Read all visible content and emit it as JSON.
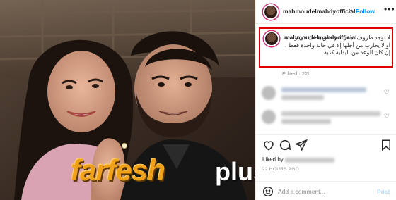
{
  "post": {
    "username": "mahmoudelmahdyofficial",
    "follow_label": "Follow",
    "separator": "•",
    "more_icon": "more-horizontal-icon"
  },
  "caption": {
    "username": "mahmoudelmahdyofficial",
    "text": "لا توجد ظروف تجعل الشخص يخلف في وعده او لا يحارب من أجلها إلا في حالة واحدة فقط ، إن كان الوعد من البداية كذبة",
    "edited": "Edited · 22h",
    "highlight_color": "#e00000"
  },
  "actions": {
    "icons": [
      "heart-icon",
      "comment-icon",
      "share-icon",
      "bookmark-icon"
    ]
  },
  "likes": {
    "prefix": "Liked by"
  },
  "timestamp": "22 HOURS AGO",
  "comment": {
    "placeholder": "Add a comment...",
    "post_label": "Post"
  },
  "watermark": {
    "main": "farfesh",
    "sub": "plus.com"
  },
  "colors": {
    "accent": "#0095f6",
    "text": "#262626",
    "muted": "#8e8e8e",
    "watermark_orange": "#f0a11a"
  }
}
